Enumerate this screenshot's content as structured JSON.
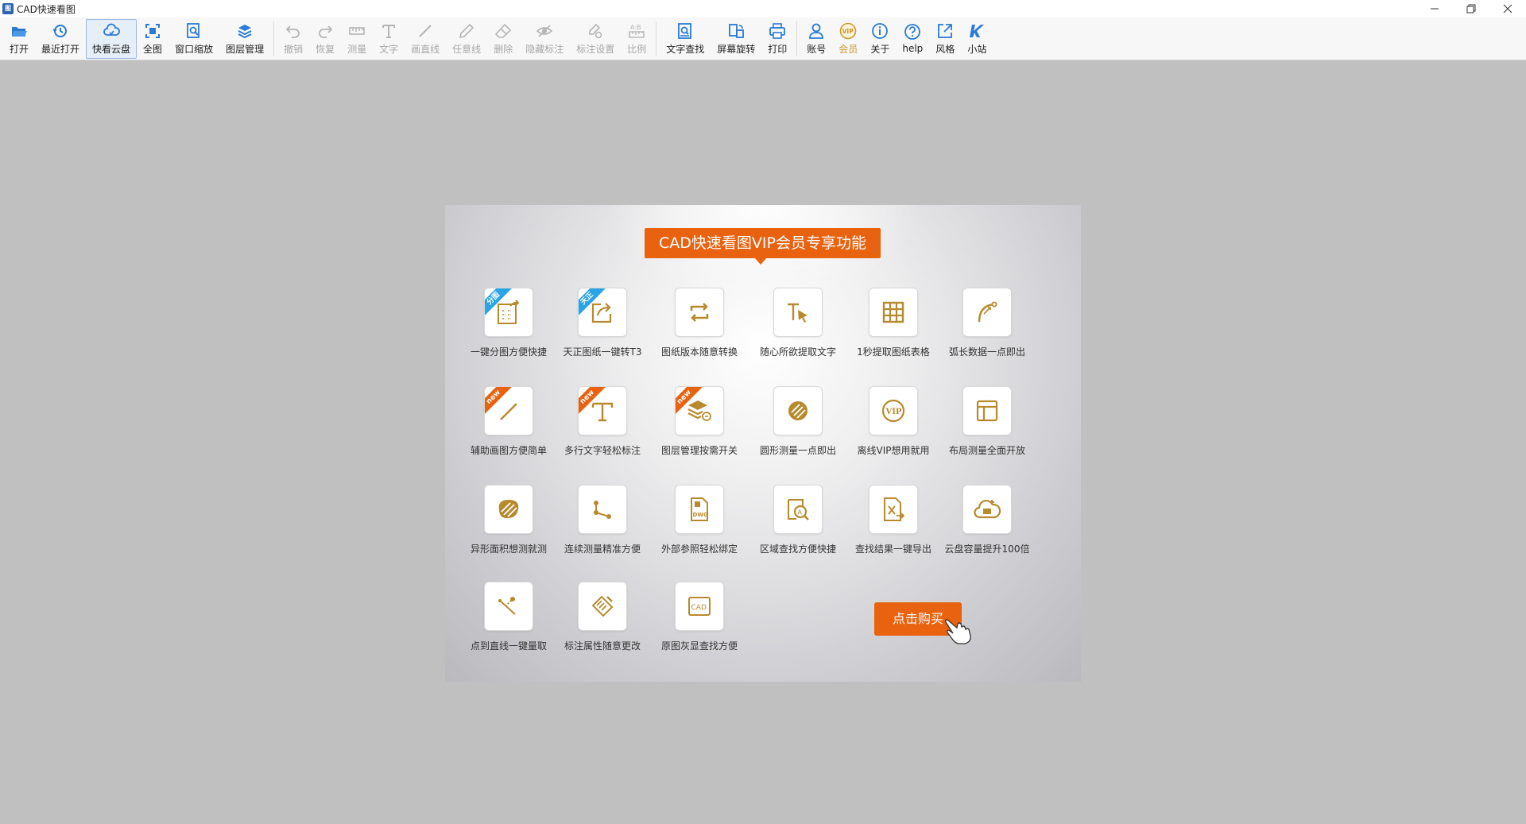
{
  "window": {
    "title": "CAD快速看图"
  },
  "toolbar": {
    "items": [
      {
        "label": "打开",
        "icon": "folder-open-icon"
      },
      {
        "label": "最近打开",
        "icon": "history-icon"
      },
      {
        "label": "快看云盘",
        "icon": "cloud-icon"
      },
      {
        "label": "全图",
        "icon": "fit-all-icon"
      },
      {
        "label": "窗口缩放",
        "icon": "zoom-window-icon"
      },
      {
        "label": "图层管理",
        "icon": "layers-icon"
      },
      {
        "label": "撤销",
        "icon": "undo-icon"
      },
      {
        "label": "恢复",
        "icon": "redo-icon"
      },
      {
        "label": "测量",
        "icon": "measure-icon"
      },
      {
        "label": "文字",
        "icon": "text-icon"
      },
      {
        "label": "画直线",
        "icon": "line-icon"
      },
      {
        "label": "任意线",
        "icon": "freehand-icon"
      },
      {
        "label": "删除",
        "icon": "eraser-icon"
      },
      {
        "label": "隐藏标注",
        "icon": "hide-annotation-icon"
      },
      {
        "label": "标注设置",
        "icon": "annotation-settings-icon"
      },
      {
        "label": "比例",
        "icon": "scale-icon"
      },
      {
        "label": "文字查找",
        "icon": "text-search-icon"
      },
      {
        "label": "屏幕旋转",
        "icon": "rotate-screen-icon"
      },
      {
        "label": "打印",
        "icon": "printer-icon"
      },
      {
        "label": "账号",
        "icon": "user-icon"
      },
      {
        "label": "会员",
        "icon": "vip-icon"
      },
      {
        "label": "关于",
        "icon": "info-icon"
      },
      {
        "label": "help",
        "icon": "help-icon"
      },
      {
        "label": "风格",
        "icon": "style-icon"
      },
      {
        "label": "小站",
        "icon": "site-icon"
      }
    ]
  },
  "vip": {
    "title": "CAD快速看图VIP会员专享功能",
    "features": [
      {
        "label": "一键分图方便快捷",
        "icon": "split-drawing-icon",
        "ribbon": "分图"
      },
      {
        "label": "天正图纸一键转T3",
        "icon": "export-icon",
        "ribbon": "天正"
      },
      {
        "label": "图纸版本随意转换",
        "icon": "convert-icon"
      },
      {
        "label": "随心所欲提取文字",
        "icon": "extract-text-icon"
      },
      {
        "label": "1秒提取图纸表格",
        "icon": "table-icon"
      },
      {
        "label": "弧长数据一点即出",
        "icon": "arc-length-icon"
      },
      {
        "label": "辅助画图方便简单",
        "icon": "draw-line-icon",
        "ribbon": "new"
      },
      {
        "label": "多行文字轻松标注",
        "icon": "multiline-text-icon",
        "ribbon": "new"
      },
      {
        "label": "图层管理按需开关",
        "icon": "layer-toggle-icon",
        "ribbon": "new"
      },
      {
        "label": "圆形测量一点即出",
        "icon": "circle-measure-icon"
      },
      {
        "label": "离线VIP想用就用",
        "icon": "offline-vip-icon"
      },
      {
        "label": "布局测量全面开放",
        "icon": "layout-icon"
      },
      {
        "label": "异形面积想测就测",
        "icon": "area-icon"
      },
      {
        "label": "连续测量精准方便",
        "icon": "continuous-measure-icon"
      },
      {
        "label": "外部参照轻松绑定",
        "icon": "xref-icon"
      },
      {
        "label": "区域查找方便快捷",
        "icon": "area-search-icon"
      },
      {
        "label": "查找结果一键导出",
        "icon": "export-excel-icon"
      },
      {
        "label": "云盘容量提升100倍",
        "icon": "cloud-storage-icon"
      },
      {
        "label": "点到直线一键量取",
        "icon": "point-line-icon"
      },
      {
        "label": "标注属性随意更改",
        "icon": "annotation-edit-icon"
      },
      {
        "label": "原图灰显查找方便",
        "icon": "cad-gray-icon"
      }
    ],
    "buy_label": "点击购买"
  },
  "colors": {
    "accent_blue": "#2a7ad6",
    "vip_orange": "#e8620f",
    "gold": "#b88a2e",
    "background": "#c0c0c0"
  }
}
